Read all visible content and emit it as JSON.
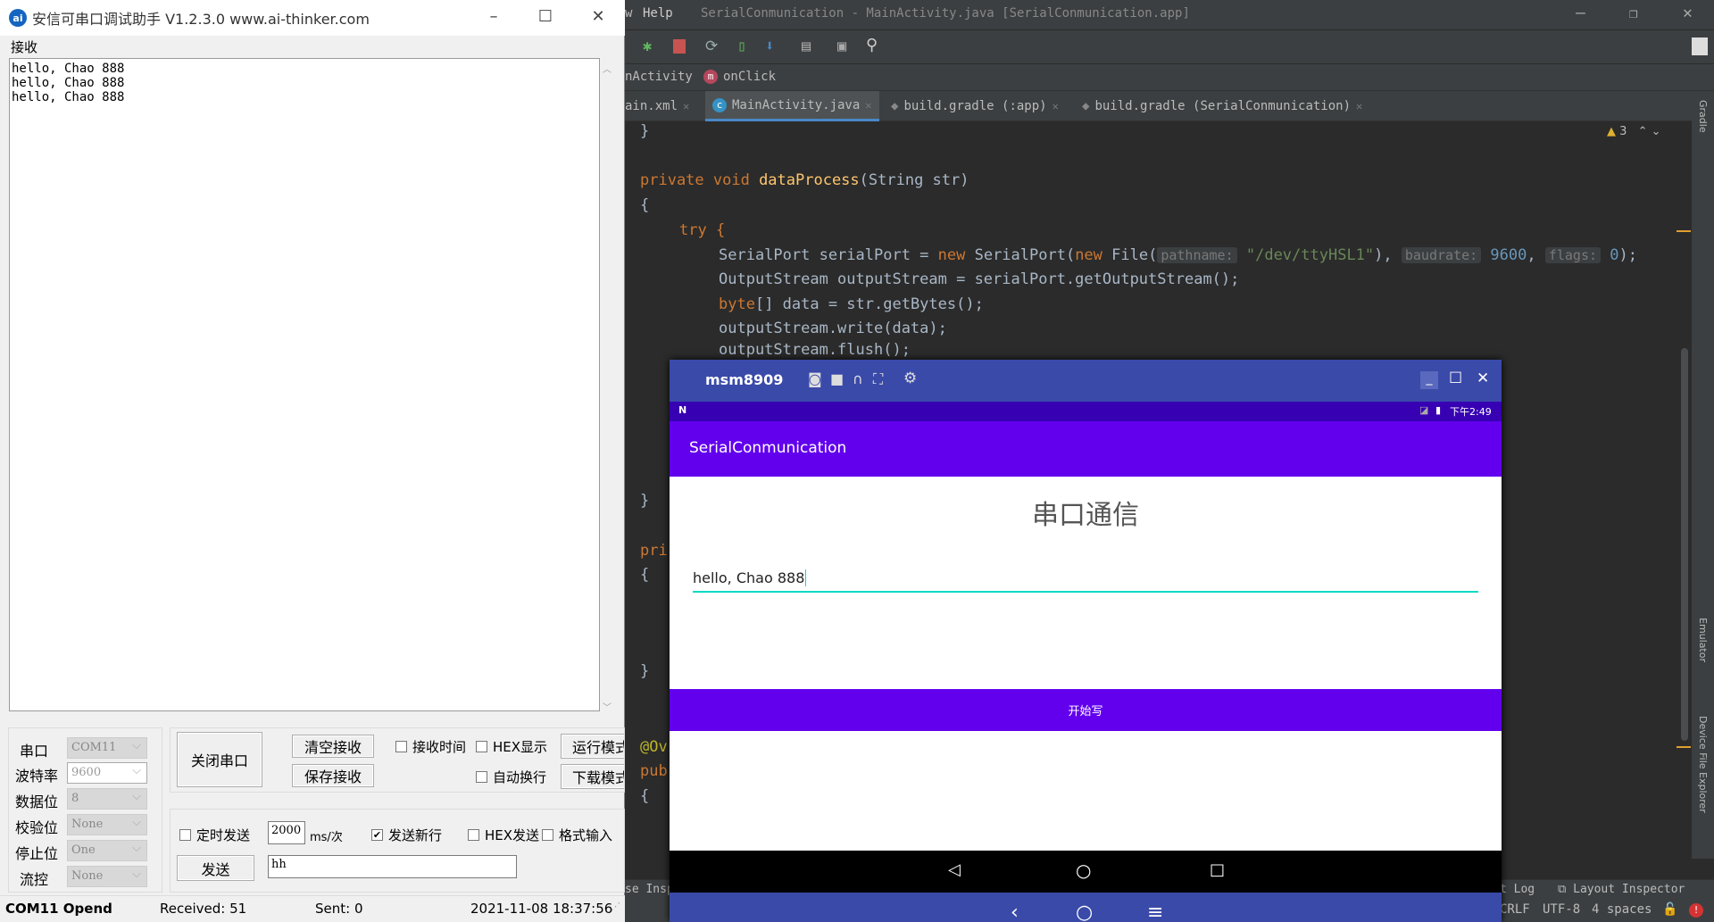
{
  "serial_tool": {
    "title": "安信可串口调试助手 V1.2.3.0    www.ai-thinker.com",
    "logo_text": "AI",
    "receive_label": "接收",
    "received_lines": [
      "hello, Chao 888",
      "hello, Chao 888",
      "hello, Chao 888"
    ],
    "settings": [
      {
        "label": "串口",
        "value": "COM11"
      },
      {
        "label": "波特率",
        "value": "9600"
      },
      {
        "label": "数据位",
        "value": "8"
      },
      {
        "label": "校验位",
        "value": "None"
      },
      {
        "label": "停止位",
        "value": "One"
      },
      {
        "label": "流控",
        "value": "None"
      }
    ],
    "buttons": {
      "close_port": "关闭串口",
      "clear_receive": "清空接收",
      "save_receive": "保存接收",
      "run_mode": "运行模式",
      "download_mode": "下载模式",
      "send": "发送"
    },
    "checkboxes": {
      "receive_time": {
        "label": "接收时间",
        "checked": false
      },
      "hex_display": {
        "label": "HEX显示",
        "checked": false
      },
      "auto_wrap": {
        "label": "自动换行",
        "checked": false
      },
      "timed_send": {
        "label": "定时发送",
        "checked": false
      },
      "send_newline": {
        "label": "发送新行",
        "checked": true
      },
      "hex_send": {
        "label": "HEX发送",
        "checked": false
      },
      "format_input": {
        "label": "格式输入",
        "checked": false
      }
    },
    "interval_value": "2000",
    "interval_unit": "ms/次",
    "send_text": "hh",
    "status": {
      "port": "COM11 Opend",
      "received": "Received: 51",
      "sent": "Sent: 0",
      "datetime": "2021-11-08 18:37:56"
    }
  },
  "ide": {
    "menu_partial": "w",
    "menu_help": "Help",
    "window_title": "SerialConmunication - MainActivity.java [SerialConmunication.app]",
    "breadcrumb": [
      "nActivity",
      "onClick"
    ],
    "tabs": [
      {
        "label": "ain.xml",
        "active": false
      },
      {
        "label": "MainActivity.java",
        "active": true
      },
      {
        "label": "build.gradle (:app)",
        "active": false
      },
      {
        "label": "build.gradle (SerialConmunication)",
        "active": false
      }
    ],
    "warnings_count": "3",
    "side_tools": [
      "Gradle",
      "Emulator",
      "Device File Explorer"
    ],
    "bottom_tools": [
      "se Insp",
      "t Log",
      "Layout Inspector"
    ],
    "status": {
      "line_sep": "CRLF",
      "encoding": "UTF-8",
      "indent": "4 spaces"
    },
    "code": {
      "l0": "}",
      "l2a": "private void ",
      "l2b": "dataProcess",
      "l2c": "(String str)",
      "l3": "{",
      "l4": "try {",
      "l5a": "SerialPort serialPort = ",
      "l5b": "new ",
      "l5c": "SerialPort(",
      "l5d": "new ",
      "l5e": "File(",
      "l5h1": "pathname:",
      "l5s": "\"/dev/ttyHSL1\"",
      "l5f": "), ",
      "l5h2": "baudrate:",
      "l5n": "9600",
      "l5g": ", ",
      "l5h3": "flags:",
      "l5n2": "0",
      "l5i": ");",
      "l6": "OutputStream outputStream = serialPort.getOutputStream();",
      "l7a": "byte",
      "l7b": "[] data = str.getBytes();",
      "l8": "outputStream.write(data);",
      "l9": "outputStream.flush();",
      "l15": "}",
      "l17": "pri",
      "l18": "{",
      "l22": "}",
      "l25": "@Ov",
      "l26": "pub",
      "l27": "{"
    }
  },
  "emulator": {
    "device_name": "msm8909",
    "status_time": "下午2:49",
    "app_title": "SerialConmunication",
    "heading": "串口通信",
    "input_value": "hello, Chao 888",
    "button_label": "开始写",
    "colors": {
      "toolbar": "#3a4aa9",
      "status_bar": "#3700b3",
      "app_bar": "#6200ee",
      "input_underline": "#03dac5"
    }
  }
}
